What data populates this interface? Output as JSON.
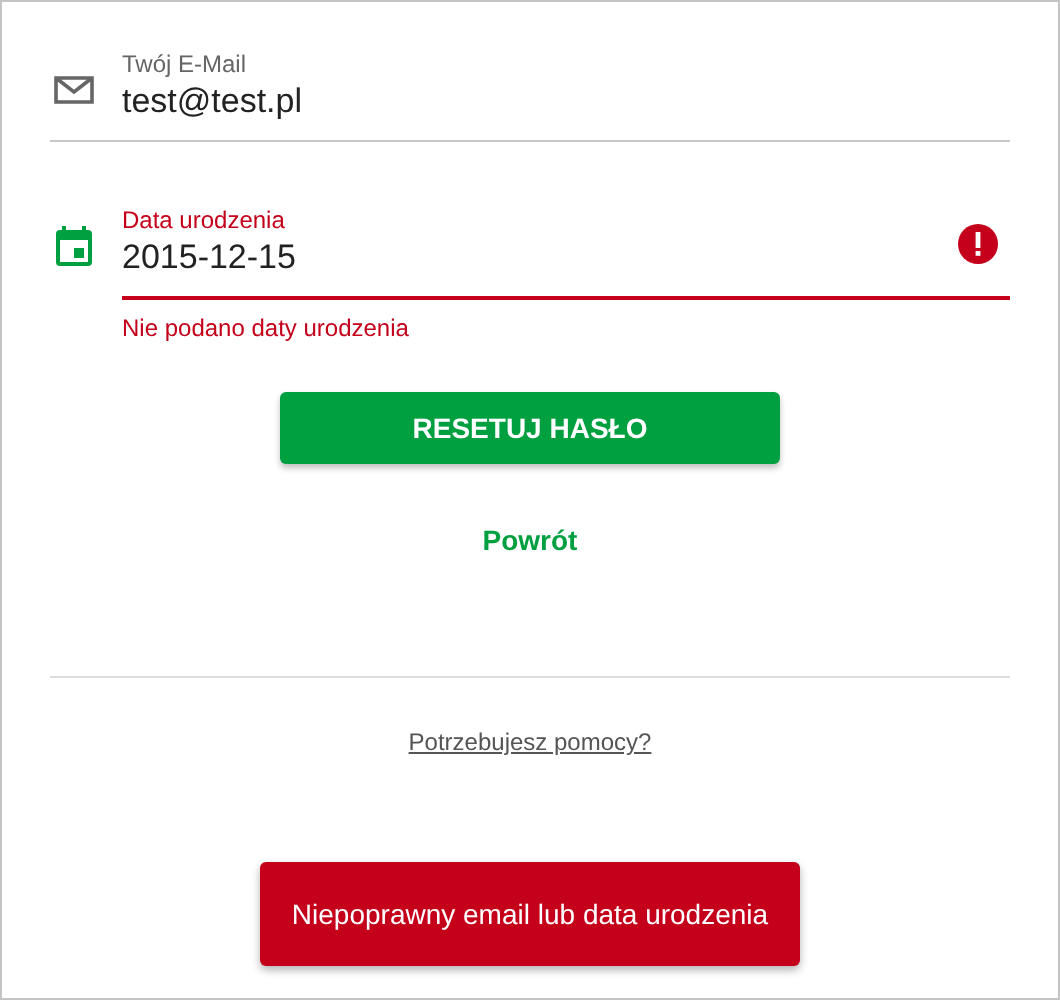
{
  "fields": [
    {
      "kind": "email",
      "label": "Twój E-Mail",
      "value": "test@test.pl",
      "error": false
    },
    {
      "kind": "date",
      "label": "Data urodzenia",
      "value": "2015-12-15",
      "error": true,
      "error_text": "Nie podano daty urodzenia"
    }
  ],
  "reset_button": "RESETUJ HASŁO",
  "back_link": "Powrót",
  "help_link": "Potrzebujesz pomocy?",
  "snackbar": "Niepoprawny email lub data urodzenia"
}
